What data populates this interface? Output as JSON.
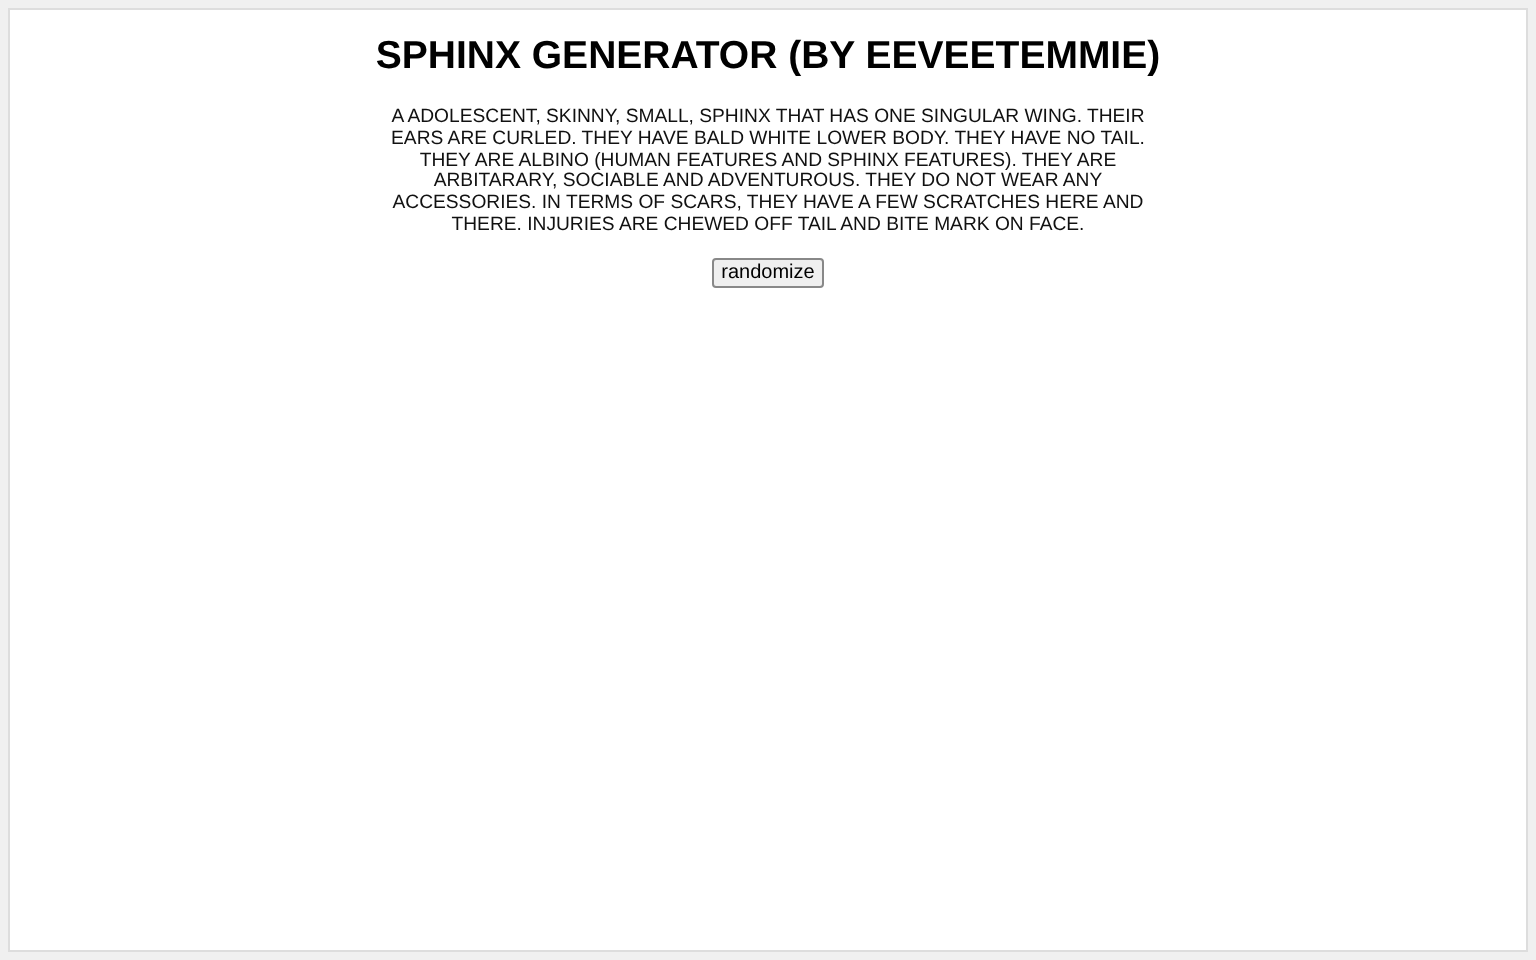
{
  "title": "SPHINX GENERATOR (BY EEVEETEMMIE)",
  "description": "A ADOLESCENT, SKINNY, SMALL, SPHINX THAT HAS ONE SINGULAR WING. THEIR EARS ARE CURLED. THEY HAVE BALD WHITE LOWER BODY. THEY HAVE NO TAIL. THEY ARE ALBINO (HUMAN FEATURES AND SPHINX FEATURES). THEY ARE ARBITARARY, SOCIABLE AND ADVENTUROUS. THEY DO NOT WEAR ANY ACCESSORIES. IN TERMS OF SCARS, THEY HAVE A FEW SCRATCHES HERE AND THERE. INJURIES ARE CHEWED OFF TAIL AND BITE MARK ON FACE.",
  "button": "randomize"
}
